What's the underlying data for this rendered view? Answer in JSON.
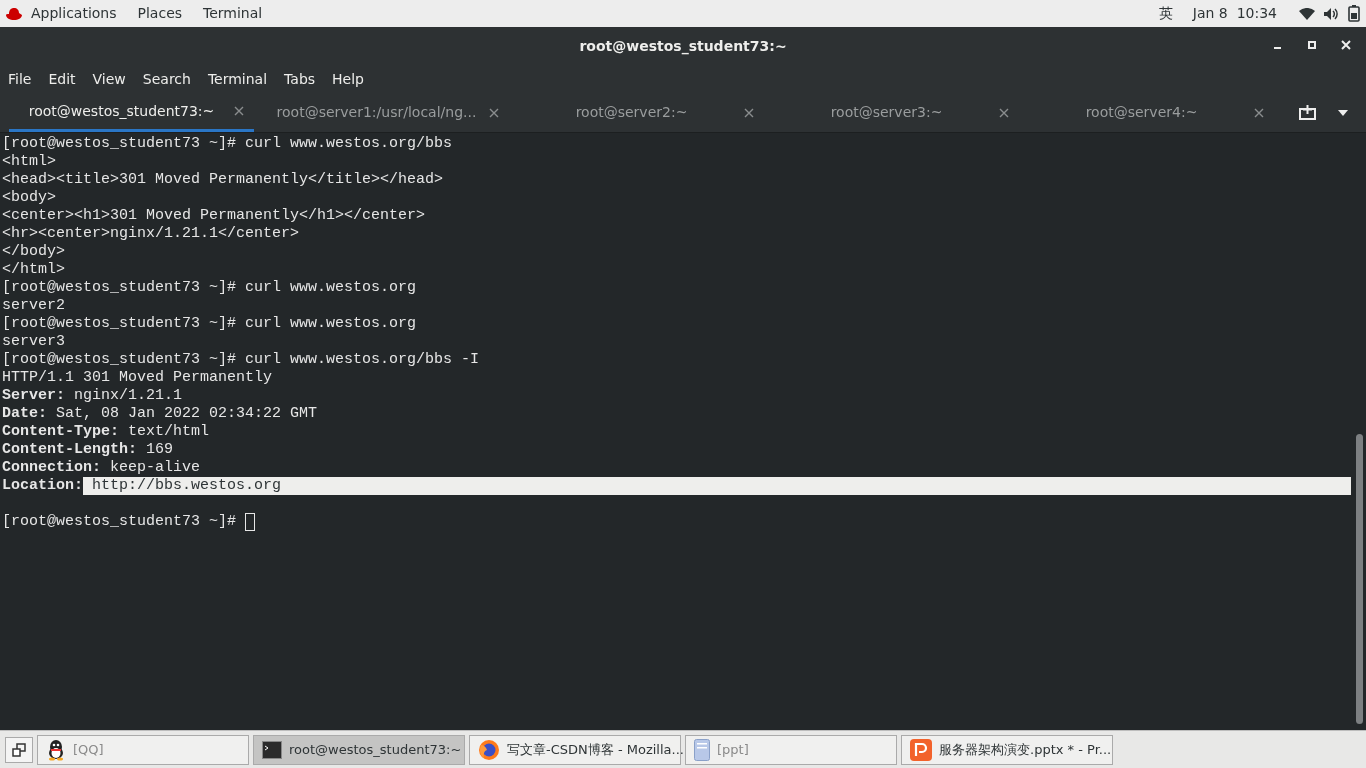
{
  "top_bar": {
    "menus": [
      "Applications",
      "Places",
      "Terminal"
    ],
    "input_method": "英",
    "clock": "Jan 8  10:34"
  },
  "window": {
    "title": "root@westos_student73:~"
  },
  "menu_bar": [
    "File",
    "Edit",
    "View",
    "Search",
    "Terminal",
    "Tabs",
    "Help"
  ],
  "tabs": [
    {
      "label": "root@westos_student73:~",
      "selected": true
    },
    {
      "label": "root@server1:/usr/local/ng...",
      "selected": false
    },
    {
      "label": "root@server2:~",
      "selected": false
    },
    {
      "label": "root@server3:~",
      "selected": false
    },
    {
      "label": "root@server4:~",
      "selected": false
    }
  ],
  "terminal": {
    "lines": [
      {
        "kind": "plain",
        "text": "[root@westos_student73 ~]# curl www.westos.org/bbs"
      },
      {
        "kind": "plain",
        "text": "<html>"
      },
      {
        "kind": "plain",
        "text": "<head><title>301 Moved Permanently</title></head>"
      },
      {
        "kind": "plain",
        "text": "<body>"
      },
      {
        "kind": "plain",
        "text": "<center><h1>301 Moved Permanently</h1></center>"
      },
      {
        "kind": "plain",
        "text": "<hr><center>nginx/1.21.1</center>"
      },
      {
        "kind": "plain",
        "text": "</body>"
      },
      {
        "kind": "plain",
        "text": "</html>"
      },
      {
        "kind": "plain",
        "text": "[root@westos_student73 ~]# curl www.westos.org"
      },
      {
        "kind": "plain",
        "text": "server2"
      },
      {
        "kind": "plain",
        "text": "[root@westos_student73 ~]# curl www.westos.org"
      },
      {
        "kind": "plain",
        "text": "server3"
      },
      {
        "kind": "plain",
        "text": "[root@westos_student73 ~]# curl www.westos.org/bbs -I"
      },
      {
        "kind": "plain",
        "text": "HTTP/1.1 301 Moved Permanently"
      },
      {
        "kind": "header",
        "name": "Server:",
        "value": "nginx/1.21.1",
        "selected": false
      },
      {
        "kind": "header",
        "name": "Date:",
        "value": "Sat, 08 Jan 2022 02:34:22 GMT",
        "selected": false
      },
      {
        "kind": "header",
        "name": "Content-Type:",
        "value": "text/html",
        "selected": false
      },
      {
        "kind": "header",
        "name": "Content-Length:",
        "value": "169",
        "selected": false
      },
      {
        "kind": "header",
        "name": "Connection:",
        "value": "keep-alive",
        "selected": false
      },
      {
        "kind": "header",
        "name": "Location:",
        "value": "http://bbs.westos.org",
        "selected": true
      },
      {
        "kind": "blank"
      },
      {
        "kind": "prompt",
        "text": "[root@westos_student73 ~]#",
        "cursor": true
      }
    ]
  },
  "taskbar": [
    {
      "kind": "qq",
      "label": "[QQ]",
      "selected": false,
      "minimized": true
    },
    {
      "kind": "terminal",
      "label": "root@westos_student73:~",
      "selected": true,
      "minimized": false
    },
    {
      "kind": "firefox",
      "label": "写文章-CSDN博客 - Mozilla...",
      "selected": false,
      "minimized": false
    },
    {
      "kind": "document",
      "label": "[ppt]",
      "selected": false,
      "minimized": true
    },
    {
      "kind": "presentation",
      "label": "服务器架构演变.pptx * - Pr...",
      "selected": false,
      "minimized": false
    }
  ]
}
